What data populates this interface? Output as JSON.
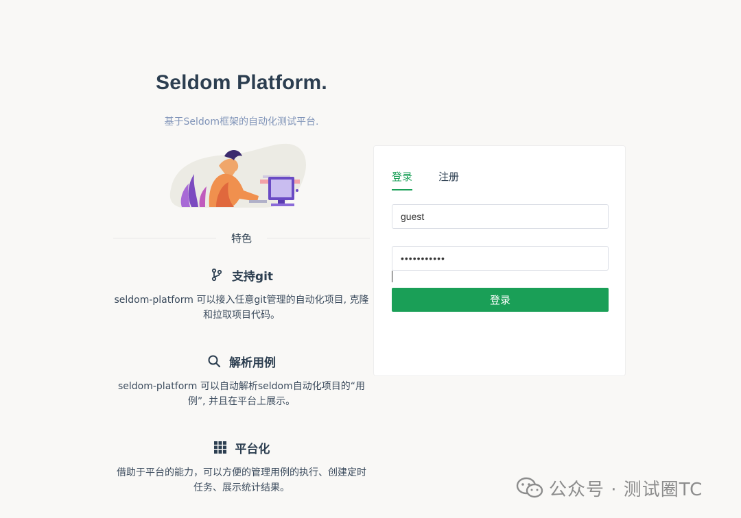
{
  "header": {
    "title": "Seldom Platform.",
    "subtitle": "基于Seldom框架的自动化测试平台."
  },
  "features": {
    "section_label": "特色",
    "items": [
      {
        "icon": "git-branch-icon",
        "title": "支持git",
        "desc": "seldom-platform 可以接入任意git管理的自动化项目, 克隆和拉取项目代码。"
      },
      {
        "icon": "search-icon",
        "title": "解析用例",
        "desc": "seldom-platform 可以自动解析seldom自动化项目的“用例”, 并且在平台上展示。"
      },
      {
        "icon": "grid-icon",
        "title": "平台化",
        "desc": "借助于平台的能力，可以方便的管理用例的执行、创建定时任务、展示统计结果。"
      }
    ]
  },
  "login": {
    "tabs": [
      "登录",
      "注册"
    ],
    "active_tab": "登录",
    "username": "guest",
    "password": "•••••••••••",
    "submit_label": "登录",
    "accent_color": "#1a9f57"
  },
  "watermark": {
    "text": "公众号 · 测试圈TC"
  }
}
